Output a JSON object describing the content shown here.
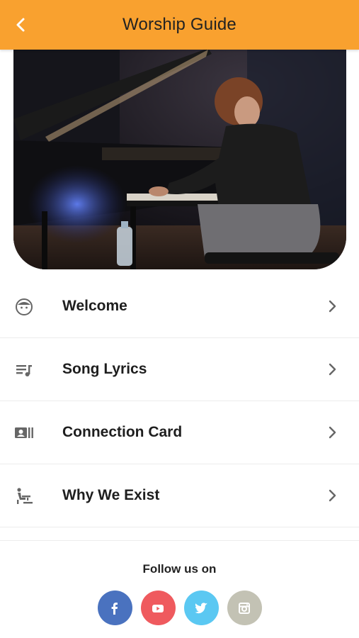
{
  "header": {
    "title": "Worship Guide",
    "back_icon": "chevron-left-icon",
    "background": "#f9a12f"
  },
  "hero": {
    "image": "pianist-playing-grand-piano-photo"
  },
  "menu": {
    "items": [
      {
        "label": "Welcome",
        "icon": "face-icon"
      },
      {
        "label": "Song Lyrics",
        "icon": "playlist-music-icon"
      },
      {
        "label": "Connection Card",
        "icon": "contact-card-icon"
      },
      {
        "label": "Why We Exist",
        "icon": "seated-person-icon"
      }
    ]
  },
  "follow": {
    "label": "Follow us on",
    "socials": [
      {
        "name": "facebook",
        "icon": "facebook-icon",
        "color": "#4a72bf"
      },
      {
        "name": "youtube",
        "icon": "youtube-icon",
        "color": "#ef5a5e"
      },
      {
        "name": "twitter",
        "icon": "twitter-icon",
        "color": "#5bc8f2"
      },
      {
        "name": "instagram",
        "icon": "instagram-icon",
        "color": "#c3c2b4"
      }
    ]
  }
}
